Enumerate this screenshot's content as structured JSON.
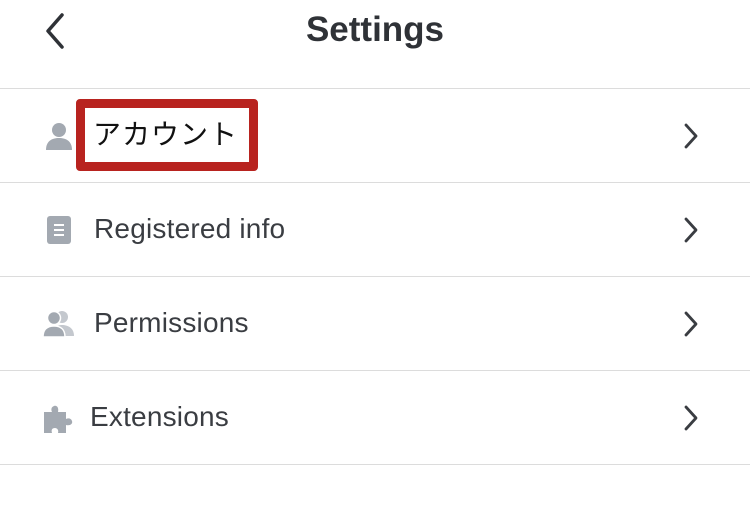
{
  "header": {
    "title": "Settings",
    "back_icon": "chevron-left-icon"
  },
  "items": [
    {
      "id": "account",
      "label": "アカウント",
      "icon": "user-icon",
      "highlighted": true,
      "highlight_color": "#b8231f"
    },
    {
      "id": "registered-info",
      "label": "Registered info",
      "icon": "document-icon"
    },
    {
      "id": "permissions",
      "label": "Permissions",
      "icon": "users-icon"
    },
    {
      "id": "extensions",
      "label": "Extensions",
      "icon": "puzzle-icon"
    }
  ],
  "colors": {
    "icon": "#a3a9b1",
    "text": "#3a3d42",
    "divider": "#dcdcdc",
    "chevron": "#3a3d42"
  }
}
